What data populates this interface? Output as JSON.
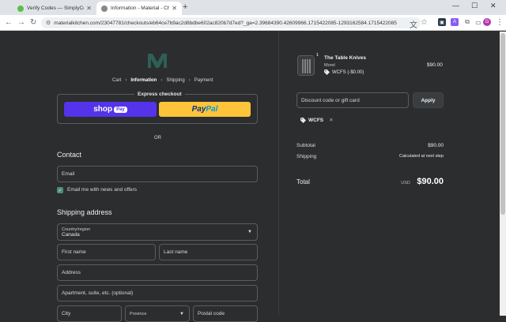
{
  "browser": {
    "tabs": [
      {
        "title": "Verify Codes — SimplyCodes",
        "active": false
      },
      {
        "title": "Information - Material - Checkout",
        "active": true
      }
    ],
    "url": "materialkitchen.com/23047781/checkouts/eb64ce7b9ac2d8bdbe602ac820b7d7ed?_ga=2.39684390.42609966.1715422085-1293162584.1715422085"
  },
  "breadcrumb": {
    "cart": "Cart",
    "information": "Information",
    "shipping": "Shipping",
    "payment": "Payment"
  },
  "express": {
    "label": "Express checkout",
    "shoppay_text": "shop",
    "shoppay_badge": "Pay",
    "paypal_p1": "Pay",
    "paypal_p2": "Pal"
  },
  "or_text": "OR",
  "contact": {
    "heading": "Contact",
    "email_placeholder": "Email",
    "newsletter_label": "Email me with news and offers",
    "newsletter_checked": true
  },
  "shipping_address": {
    "heading": "Shipping address",
    "country_label": "Country/region",
    "country_value": "Canada",
    "first_name": "First name",
    "last_name": "Last name",
    "address": "Address",
    "apartment": "Apartment, suite, etc. (optional)",
    "city": "City",
    "province_label": "Province",
    "postal_code": "Postal code"
  },
  "order": {
    "quantity": "1",
    "product_name": "The Table Knives",
    "vendor": "Morel",
    "discount_line": "WCFS (-$0.00)",
    "price": "$90.00",
    "discount_placeholder": "Discount code or gift card",
    "apply_label": "Apply",
    "applied_code": "WCFS",
    "subtotal_label": "Subtotal",
    "subtotal_value": "$90.00",
    "shipping_label": "Shipping",
    "shipping_value": "Calculated at next step",
    "total_label": "Total",
    "currency": "USD",
    "total_value": "$90.00"
  },
  "colors": {
    "background": "#2b2d2f",
    "shoppay": "#5433eb",
    "paypal": "#ffc439",
    "checkbox": "#4e8e7d",
    "logo": "#2f5f55"
  }
}
